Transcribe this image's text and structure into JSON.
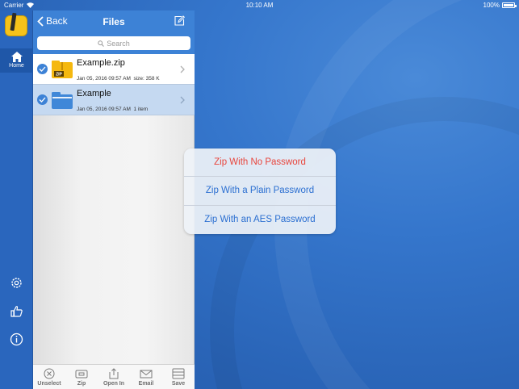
{
  "status_bar": {
    "carrier": "Carrier",
    "time": "10:10 AM",
    "battery": "100%"
  },
  "rail": {
    "home_label": "Home"
  },
  "nav": {
    "back_label": "Back",
    "title": "Files"
  },
  "search": {
    "placeholder": "Search"
  },
  "files": [
    {
      "name": "Example.zip",
      "date": "Jan 05, 2016 09:57 AM",
      "detail": "size: 358 K",
      "type": "zip-file-icon"
    },
    {
      "name": "Example",
      "date": "Jan 05, 2016 09:57 AM",
      "detail": "1 item",
      "type": "folder-icon"
    }
  ],
  "toolbar": {
    "unselect": "Unselect",
    "zip": "Zip",
    "open_in": "Open In",
    "email": "Email",
    "save": "Save"
  },
  "popup": {
    "items": [
      "Zip With No Password",
      "Zip With a Plain Password",
      "Zip With an AES Password"
    ]
  },
  "colors": {
    "accent": "#3d82d6",
    "destructive": "#e8453c",
    "desktop": "#2f6fc4"
  }
}
